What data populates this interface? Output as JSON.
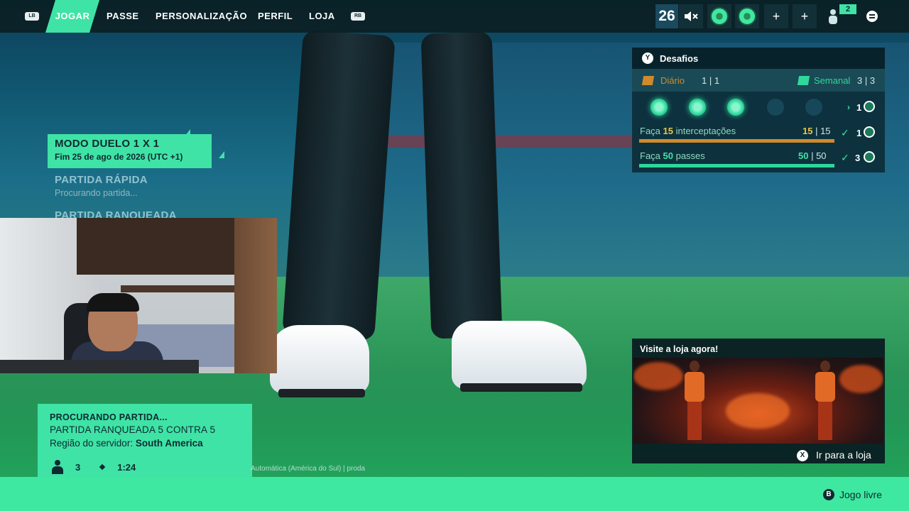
{
  "topbar": {
    "left_bumper": "LB",
    "right_bumper": "RB",
    "tabs": [
      "JOGAR",
      "PASSE",
      "PERSONALIZAÇÃO",
      "PERFIL",
      "LOJA"
    ],
    "player_level": "26",
    "muted_icon": "speaker-muted-icon",
    "friends_online": "2"
  },
  "modes": {
    "selected_title": "MODO DUELO 1 X 1",
    "selected_subtitle": "Fim 25 de ago de 2026 (UTC +1)",
    "quick_match_title": "PARTIDA RÁPIDA",
    "quick_match_sub": "Procurando partida...",
    "ranked_title": "PARTIDA RANQUEADA"
  },
  "challenges": {
    "button": "Y",
    "title": "Desafios",
    "daily_label": "Diário",
    "daily_count": "1 | 1",
    "weekly_label": "Semanal",
    "weekly_count": "3 | 3",
    "chain_reward": "1",
    "tasks": [
      {
        "prefix": "Faça ",
        "value": "15",
        "suffix": " interceptações",
        "done": "15",
        "total": " | 15",
        "reward": "1"
      },
      {
        "prefix": "Faça ",
        "value": "50",
        "suffix": " passes",
        "done": "50",
        "total": " | 50",
        "reward": "3"
      }
    ],
    "colors": {
      "daily": "#d08a2c",
      "weekly": "#2fd79b"
    }
  },
  "search": {
    "status": "PROCURANDO PARTIDA...",
    "mode": "PARTIDA RANQUEADA 5 CONTRA 5",
    "region_label": "Região do servidor: ",
    "region_value": "South America",
    "players": "3",
    "timer": "1:24",
    "server_note": "Automática (América do Sul) | proda"
  },
  "shop": {
    "title": "Visite a loja agora!",
    "button": "X",
    "cta": "Ir para a loja"
  },
  "footer": {
    "button": "B",
    "label": "Jogo livre"
  },
  "colors": {
    "accent": "#3fe3a6",
    "dark_text": "#0e2a30",
    "panel": "#0c2e38"
  }
}
